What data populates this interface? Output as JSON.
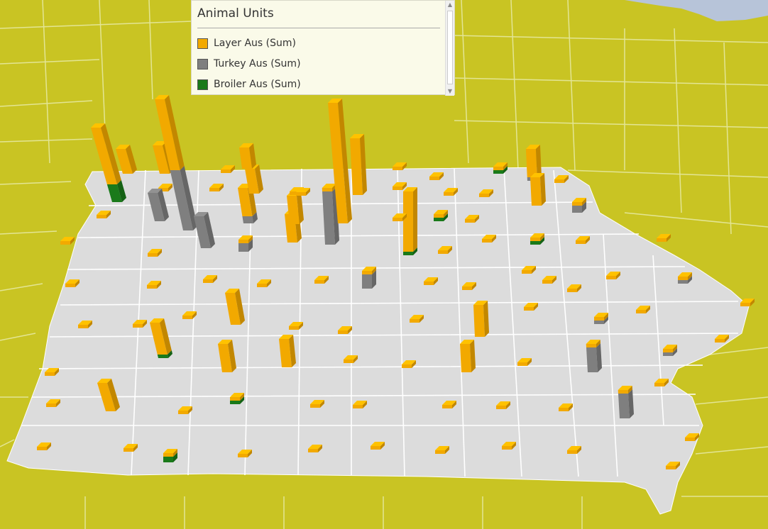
{
  "legend": {
    "title": "Animal Units",
    "items": [
      {
        "label": "Layer Aus (Sum)",
        "color": "#f2a900"
      },
      {
        "label": "Turkey Aus (Sum)",
        "color": "#7f7f7f"
      },
      {
        "label": "Broiler Aus (Sum)",
        "color": "#1a7a1a"
      }
    ]
  },
  "map_colors": {
    "land": "#c9c423",
    "state": "#dcdcdc",
    "border": "#ffffff",
    "water": "#b7c4d9"
  }
}
